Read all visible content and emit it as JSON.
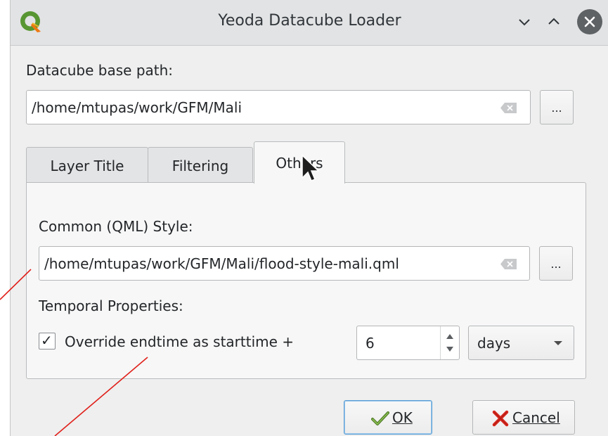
{
  "window": {
    "title": "Yeoda Datacube Loader",
    "title_icons": [
      "qgis-logo-icon",
      "minimize-chevron-icon",
      "maximize-chevron-icon",
      "close-icon"
    ]
  },
  "base_path": {
    "label": "Datacube base path:",
    "value": "/home/mtupas/work/GFM/Mali",
    "browse_label": "..."
  },
  "tabs": [
    {
      "label": "Layer Title",
      "active": false
    },
    {
      "label": "Filtering",
      "active": false
    },
    {
      "label": "Others",
      "active": true
    }
  ],
  "others": {
    "style_label": "Common (QML) Style:",
    "style_value": "/home/mtupas/work/GFM/Mali/flood-style-mali.qml",
    "browse_label": "...",
    "temporal_label": "Temporal Properties:",
    "override_label": "Override endtime as starttime +",
    "override_checked": true,
    "spin_value": "6",
    "unit_selected": "days"
  },
  "buttons": {
    "ok_label": "OK",
    "cancel_label": "Cancel"
  },
  "colors": {
    "titlebar": "#e2e3e4",
    "ok_focus": "#5a9fd6",
    "annotation_line": "#e0201a",
    "qgis_green": "#589632",
    "qgis_yellow": "#ee7913"
  }
}
